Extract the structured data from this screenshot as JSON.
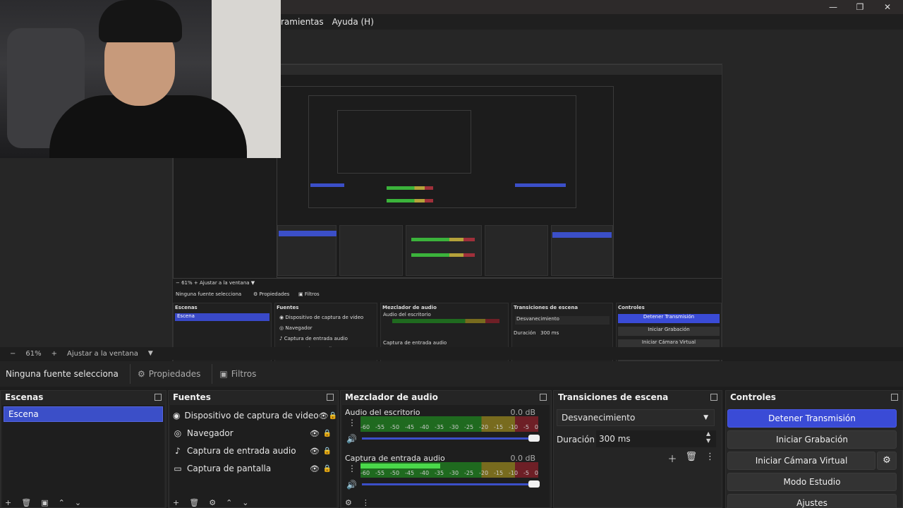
{
  "menu": {
    "items": [
      "ramientas",
      "Ayuda (H)"
    ]
  },
  "window_controls": {
    "minimize": "—",
    "maximize": "❐",
    "close": "✕"
  },
  "preview": {
    "zoom_minus": "−",
    "zoom_level": "61%",
    "zoom_plus": "+",
    "fit_label": "Ajustar a la ventana",
    "fit_arrow": "▼"
  },
  "source_toolbar": {
    "none_selected": "Ninguna fuente selecciona",
    "properties": "Propiedades",
    "filters": "Filtros"
  },
  "scenes": {
    "title": "Escenas",
    "items": [
      "Escena"
    ],
    "footer": [
      "+",
      "🗑",
      "▣",
      "⌃",
      "⌄"
    ]
  },
  "sources": {
    "title": "Fuentes",
    "items": [
      {
        "name": "Dispositivo de captura de video",
        "icon": "camera-icon"
      },
      {
        "name": "Navegador",
        "icon": "globe-icon"
      },
      {
        "name": "Captura de entrada audio",
        "icon": "microphone-icon"
      },
      {
        "name": "Captura de pantalla",
        "icon": "monitor-icon"
      }
    ],
    "footer": [
      "+",
      "🗑",
      "⚙",
      "⌃",
      "⌄"
    ]
  },
  "mixer": {
    "title": "Mezclador de audio",
    "channels": [
      {
        "name": "Audio del escritorio",
        "db": "0.0 dB",
        "level": 0.0
      },
      {
        "name": "Captura de entrada audio",
        "db": "0.0 dB",
        "level": 0.45
      }
    ],
    "ticks": [
      "-60",
      "-55",
      "-50",
      "-45",
      "-40",
      "-35",
      "-30",
      "-25",
      "-20",
      "-15",
      "-10",
      "-5",
      "0"
    ],
    "footer": [
      "⚙",
      "⋮"
    ]
  },
  "transitions": {
    "title": "Transiciones de escena",
    "selected": "Desvanecimiento",
    "duration_label": "Duración",
    "duration_value": "300 ms"
  },
  "controls": {
    "title": "Controles",
    "stop_stream": "Detener Transmisión",
    "start_recording": "Iniciar Grabación",
    "virtual_cam": "Iniciar Cámara Virtual",
    "studio_mode": "Modo Estudio",
    "settings": "Ajustes"
  },
  "colors": {
    "accent": "#3b4fc8",
    "background": "#1d1d1d",
    "dock": "#252525"
  }
}
